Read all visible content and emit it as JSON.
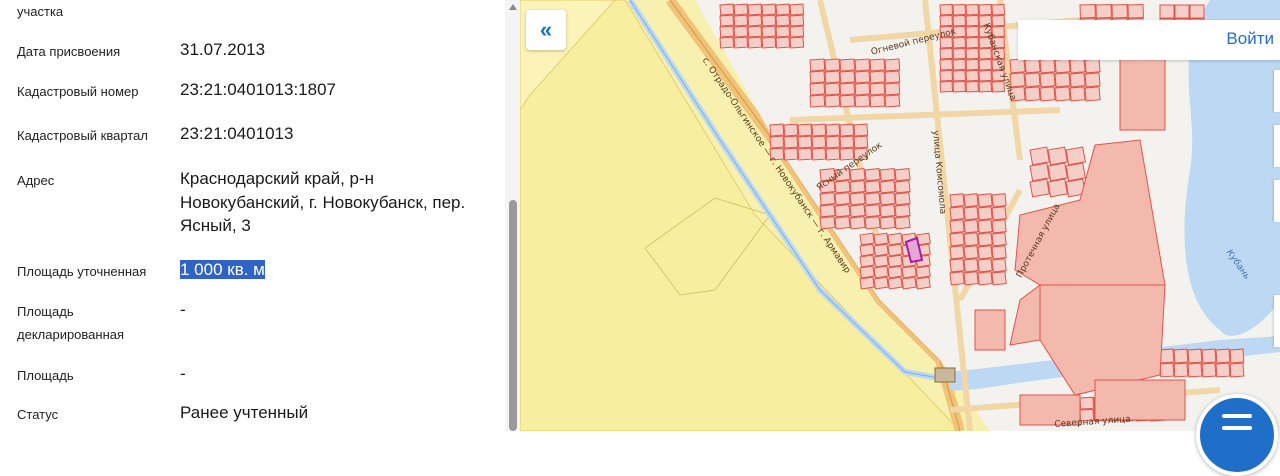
{
  "panel": {
    "rows": [
      {
        "label": "участка",
        "value": ""
      },
      {
        "label": "Дата присвоения",
        "value": "31.07.2013"
      },
      {
        "label": "Кадастровый номер",
        "value": "23:21:0401013:1807"
      },
      {
        "label": "Кадастровый квартал",
        "value": "23:21:0401013"
      },
      {
        "label": "Адрес",
        "value_lines": [
          "Краснодарский край, р-н",
          "Новокубанский, г. Новокубанск, пер.",
          "Ясный, 3"
        ]
      },
      {
        "label": "Площадь уточненная",
        "value": "1 000 кв. м"
      },
      {
        "label_lines": [
          "Площадь",
          "декларированная"
        ],
        "value": "-"
      },
      {
        "label": "Площадь",
        "value": "-"
      },
      {
        "label": "Статус",
        "value": "Ранее учтенный"
      }
    ]
  },
  "map": {
    "login_label": "Войти",
    "streets": [
      "Огневой переулок",
      "Кубанская улица",
      "улица Комсомола",
      "Ясный переулок",
      "с. Отрадо-Ольгинское — г. Новокубанск — г. Армавир",
      "Протечная улица",
      "Северная улица"
    ],
    "river": "Кубань",
    "colors": {
      "field": "#f7f0ae",
      "parcel_fill": "#f5cfc7",
      "parcel_stroke": "#e0544a",
      "road": "#f0c27a",
      "water": "#bcd8f3",
      "selected": "#a020a0"
    }
  },
  "icons": {
    "collapse": "double-chevron-left-icon",
    "menu": "menu-icon"
  }
}
